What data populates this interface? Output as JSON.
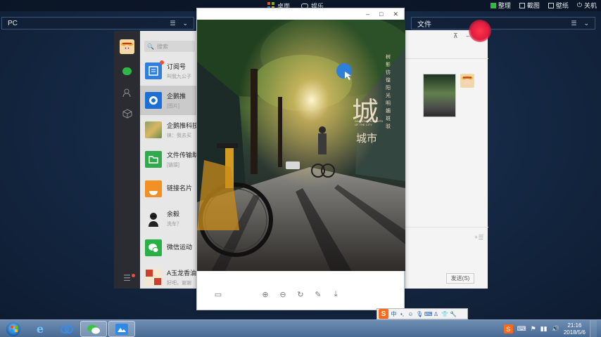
{
  "topbar": {
    "desktop_label": "桌面",
    "music_label": "娱乐",
    "buttons": [
      {
        "label": "整理",
        "icon": "organize-icon"
      },
      {
        "label": "截图",
        "icon": "screenshot-icon"
      },
      {
        "label": "壁纸",
        "icon": "wallpaper-icon"
      },
      {
        "label": "关机",
        "icon": "power-icon"
      }
    ]
  },
  "panels": {
    "left_title": "PC",
    "right_title": "文件"
  },
  "wechat": {
    "search_placeholder": "搜索",
    "chats": [
      {
        "name": "订阅号",
        "preview": "叫我九公子",
        "color": "#2f7fe0"
      },
      {
        "name": "企鹅推",
        "preview": "[图片]",
        "color": "#1b6fd6"
      },
      {
        "name": "企鹅推科技",
        "preview": "徕：我去买",
        "color": "#8fa06a"
      },
      {
        "name": "文件传输助手",
        "preview": "[链接]",
        "color": "#33a84d"
      },
      {
        "name": "链接名片",
        "preview": "",
        "color": "#f29024"
      },
      {
        "name": "余毅",
        "preview": "洗车？",
        "color": "#dcdcdc"
      },
      {
        "name": "微信运动",
        "preview": "",
        "color": "#29b045"
      },
      {
        "name": "A玉龙香油",
        "preview": "好吧，谢谢",
        "color": "#c9412e"
      }
    ]
  },
  "viewer": {
    "poster_big_char": "城",
    "poster_title": "城市",
    "poster_sub": "SHADOWS & LIGHTS OF THE CITY",
    "poster_vertical": "树 影 彷 徨 阳 光 明 媚 斑 驳"
  },
  "chat_window": {
    "send_label": "发送(S)"
  },
  "taskbar": {
    "time": "21:16",
    "date": "2018/5/6"
  },
  "ime": {
    "mode": "中"
  }
}
